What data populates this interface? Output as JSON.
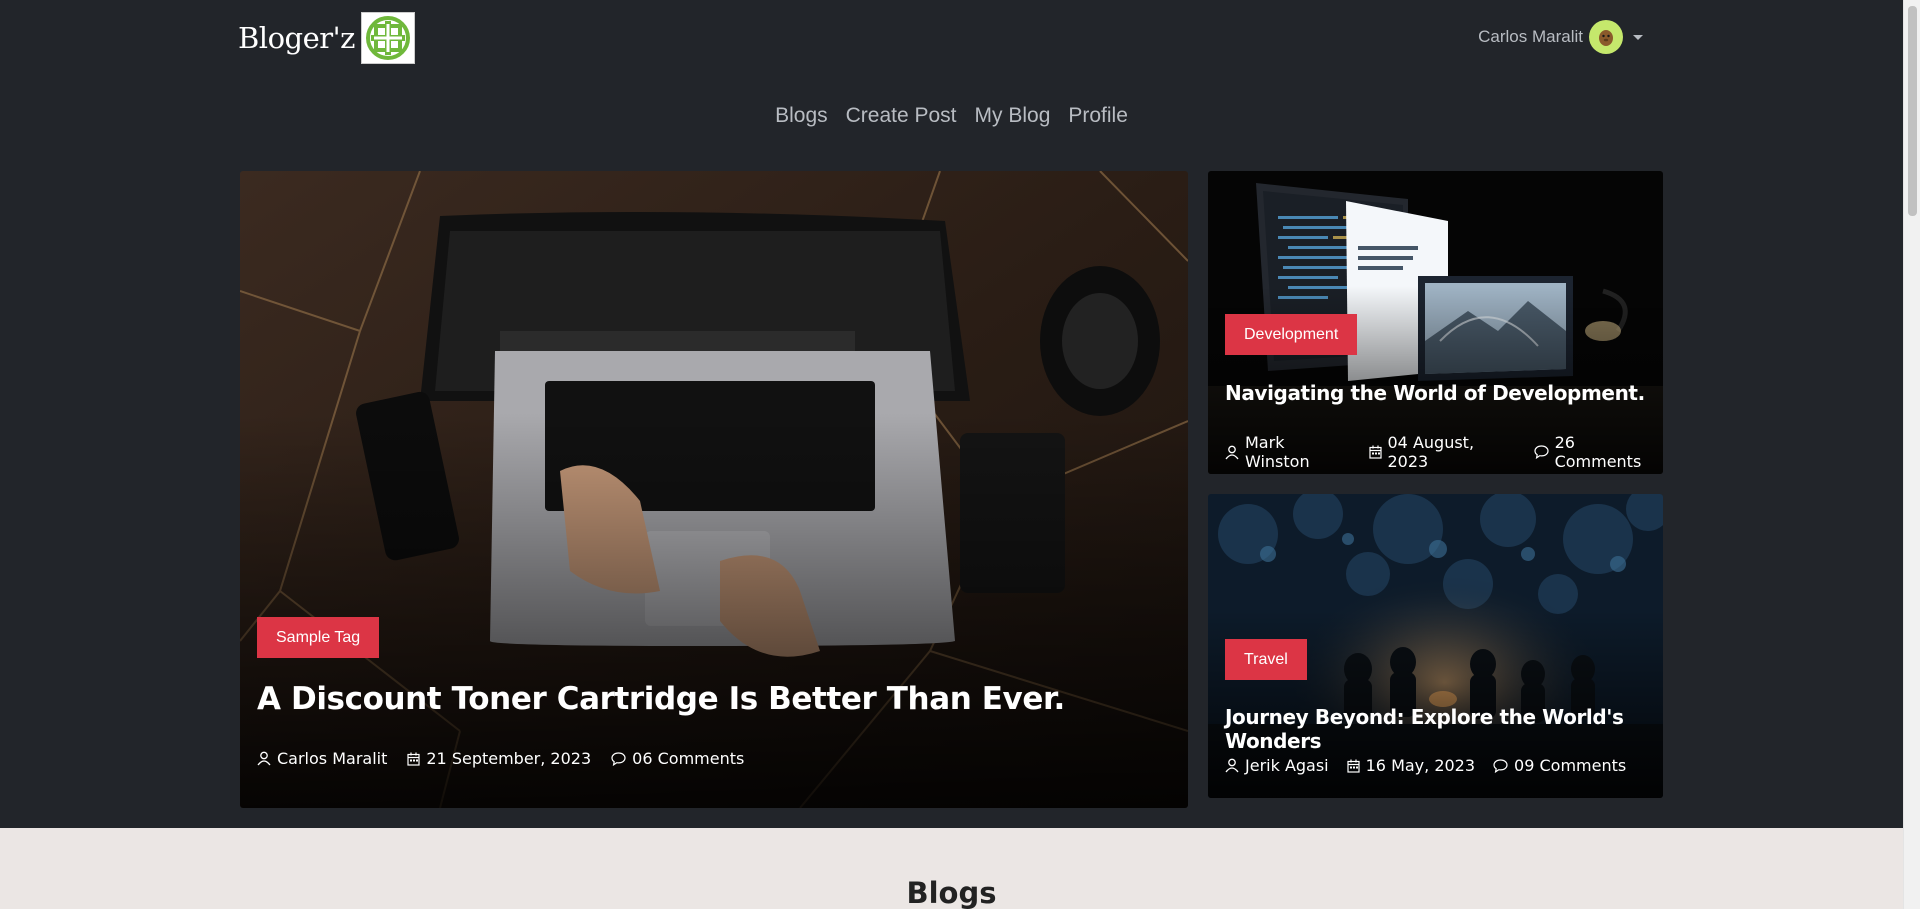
{
  "brand": {
    "name": "Bloger'z"
  },
  "user": {
    "name": "Carlos Maralit"
  },
  "nav": {
    "items": [
      "Blogs",
      "Create Post",
      "My Blog",
      "Profile"
    ]
  },
  "featured": [
    {
      "tag": "Sample Tag",
      "title": "A Discount Toner Cartridge Is Better Than Ever.",
      "author": "Carlos Maralit",
      "date": "21 September, 2023",
      "comments": "06 Comments"
    },
    {
      "tag": "Development",
      "title": "Navigating the World of Development.",
      "author": "Mark Winston",
      "date": "04 August, 2023",
      "comments": "26 Comments"
    },
    {
      "tag": "Travel",
      "title": "Journey Beyond: Explore the World's Wonders",
      "author": "Jerik Agasi",
      "date": "16 May, 2023",
      "comments": "09 Comments"
    }
  ],
  "section": {
    "title": "Blogs"
  },
  "colors": {
    "background": "#22252a",
    "tag": "#dc3545",
    "section_bg": "#ebe6e4",
    "nav_text": "#b8bcc2"
  },
  "icons": [
    "logo-icon",
    "avatar-icon",
    "user-icon",
    "calendar-icon",
    "comment-icon",
    "chevron-down-icon"
  ]
}
